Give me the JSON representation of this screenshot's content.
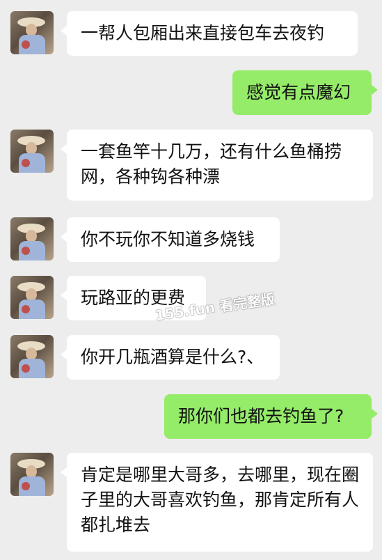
{
  "messages": [
    {
      "side": "left",
      "text": "一帮人包厢出来直接包车去夜钓"
    },
    {
      "side": "right",
      "text": "感觉有点魔幻"
    },
    {
      "side": "left",
      "text": "一套鱼竿十几万，还有什么鱼桶捞网，各种钩各种漂"
    },
    {
      "side": "left",
      "text": "你不玩你不知道多烧钱"
    },
    {
      "side": "left",
      "text": "玩路亚的更费"
    },
    {
      "side": "left",
      "text": "你开几瓶酒算是什么?、"
    },
    {
      "side": "right",
      "text": "那你们也都去钓鱼了?"
    },
    {
      "side": "left",
      "text": "肯定是哪里大哥多，去哪里，现在圈子里的大哥喜欢钓鱼，那肯定所有人都扎堆去"
    }
  ],
  "watermark": "155.fun 看完整版",
  "colors": {
    "background": "#ededed",
    "incoming_bubble": "#ffffff",
    "outgoing_bubble": "#95ec69"
  }
}
